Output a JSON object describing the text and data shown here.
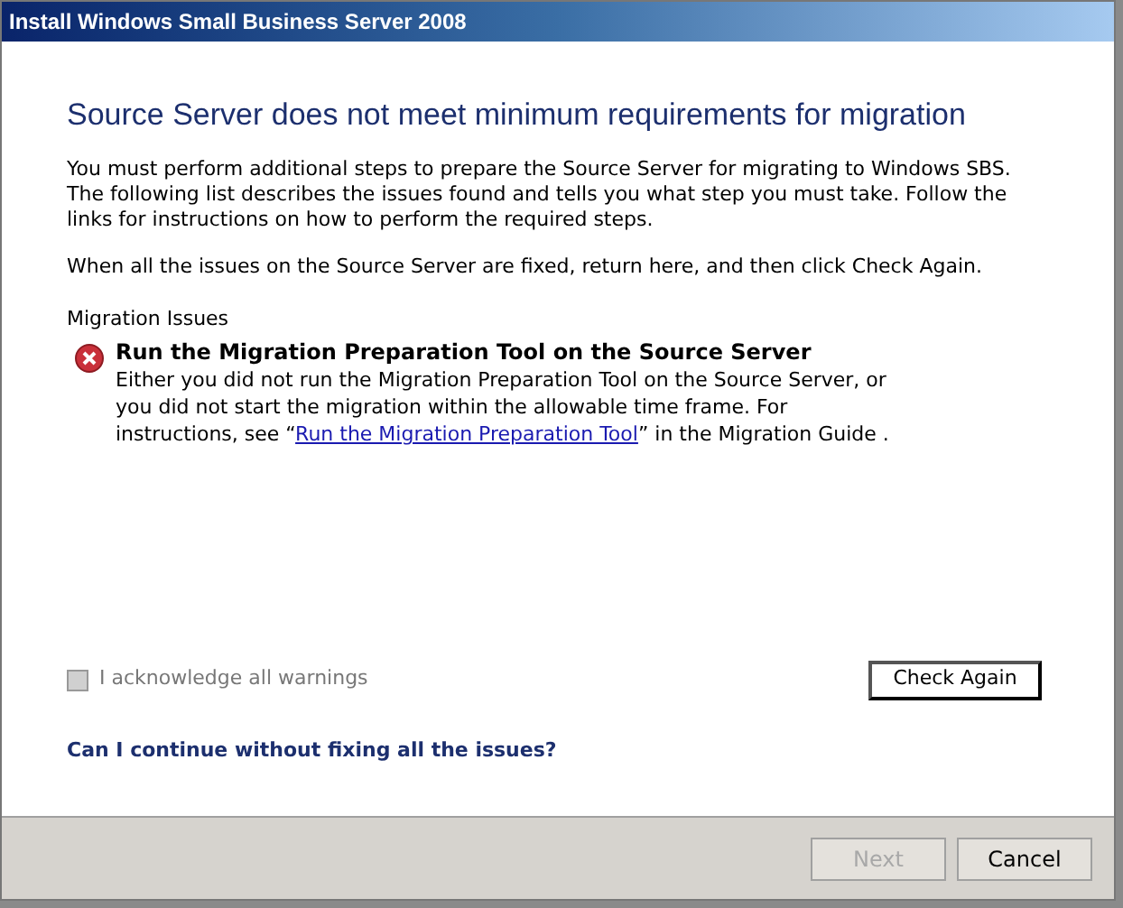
{
  "window": {
    "title": "Install Windows Small Business Server 2008"
  },
  "heading": "Source Server does not meet minimum requirements for migration",
  "paragraphs": [
    "You must perform additional steps to prepare the Source Server for migrating to Windows SBS. The following list describes the issues found and tells you what step you must take. Follow the links for instructions on how to perform the required steps.",
    "When all the issues on the Source Server are fixed, return here, and then click Check Again."
  ],
  "issues_label": "Migration Issues",
  "issues": [
    {
      "kind": "error",
      "title": "Run the Migration Preparation Tool on the Source Server",
      "text_before": "Either you did not run the Migration Preparation Tool on the Source Server, or you did not start the migration within the allowable time frame. For instructions, see “",
      "link": "Run the Migration Preparation Tool",
      "text_after": "” in the Migration Guide ."
    }
  ],
  "acknowledge": {
    "label": "I acknowledge all warnings",
    "checked": false,
    "disabled": true
  },
  "check_again_button": "Check Again",
  "help_link": "Can I continue without fixing all the issues?",
  "buttons": [
    {
      "label": "Next",
      "disabled": true
    },
    {
      "label": "Cancel",
      "disabled": false
    }
  ]
}
